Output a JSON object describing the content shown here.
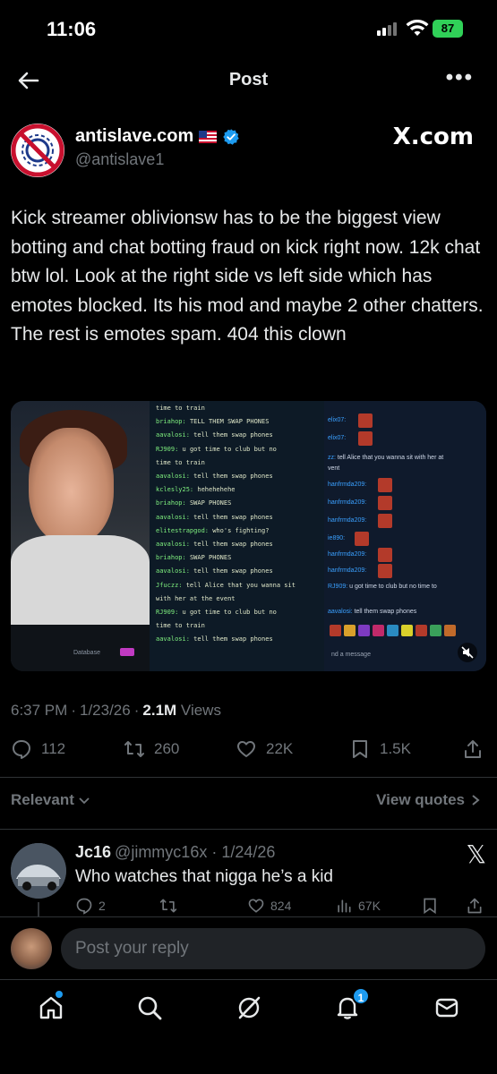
{
  "status_bar": {
    "time": "11:06",
    "battery": "87"
  },
  "header": {
    "title": "Post"
  },
  "post": {
    "author_name": "antislave.com",
    "author_handle": "@antislave1",
    "affiliate_label": "X.com",
    "text": "Kick streamer oblivionsw has to be the biggest view botting and chat botting fraud on kick right now. 12k chat btw lol. Look at the right side vs left side which has emotes blocked. Its his mod and maybe 2 other chatters. The rest is emotes spam. 404 this clown",
    "time": "6:37 PM",
    "date": "1/23/26",
    "views_count": "2.1M",
    "views_label": "Views",
    "replies": "112",
    "reposts": "260",
    "likes": "22K",
    "bookmarks": "1.5K"
  },
  "media": {
    "desk_label": "Database",
    "chat_left": [
      {
        "user": "",
        "msg": "time to train"
      },
      {
        "user": "briahop:",
        "msg": "TELL THEM SWAP PHONES"
      },
      {
        "user": "aavalosi:",
        "msg": "tell them swap phones"
      },
      {
        "user": "RJ909:",
        "msg": "u got time to club but no"
      },
      {
        "user": "",
        "msg": "time to train"
      },
      {
        "user": "aavalosi:",
        "msg": "tell them swap phones"
      },
      {
        "user": "kclesly25:",
        "msg": "hehehehehe"
      },
      {
        "user": "briahop:",
        "msg": "SWAP PHONES"
      },
      {
        "user": "aavalosi:",
        "msg": "tell them swap phones"
      },
      {
        "user": "elitestrapgod:",
        "msg": "who's fighting?"
      },
      {
        "user": "aavalosi:",
        "msg": "tell them swap phones"
      },
      {
        "user": "briahop:",
        "msg": "SWAP PHONES"
      },
      {
        "user": "aavalosi:",
        "msg": "tell them swap phones"
      },
      {
        "user": "Jfuczz:",
        "msg": "tell Alice that you wanna sit"
      },
      {
        "user": "",
        "msg": "with her at the event"
      },
      {
        "user": "RJ909:",
        "msg": "u got time to club but no"
      },
      {
        "user": "",
        "msg": "time to train"
      },
      {
        "user": "aavalosi:",
        "msg": "tell them swap phones"
      }
    ],
    "chat_right": [
      {
        "user": "elix07:",
        "msg": ""
      },
      {
        "user": "elix07:",
        "msg": ""
      },
      {
        "user": "zz:",
        "msg": "tell Alice that you wanna sit with her at"
      },
      {
        "user": "",
        "msg": "vent"
      },
      {
        "user": "hanfrmda209:",
        "msg": ""
      },
      {
        "user": "hanfrmda209:",
        "msg": ""
      },
      {
        "user": "hanfrmda209:",
        "msg": ""
      },
      {
        "user": "ie890:",
        "msg": ""
      },
      {
        "user": "hanfrmda209:",
        "msg": ""
      },
      {
        "user": "hanfrmda209:",
        "msg": ""
      },
      {
        "user": "RJ909:",
        "msg": "u got time to club but no time to"
      },
      {
        "user": "aavalosi:",
        "msg": "tell them swap phones"
      }
    ],
    "input_placeholder": "nd a message"
  },
  "sort": {
    "label": "Relevant",
    "view_quotes": "View quotes"
  },
  "reply": {
    "name": "Jc16",
    "handle": "@jimmyc16x",
    "date": "1/24/26",
    "text": "Who watches that nigga he’s a kid",
    "replies": "2",
    "likes": "824",
    "views": "67K"
  },
  "composer": {
    "placeholder": "Post your reply"
  },
  "tabbar": {
    "notifications_badge": "1"
  },
  "colors": {
    "accent": "#1d9bf0",
    "muted": "#71767b",
    "text": "#e7e9ea",
    "battery": "#30d158"
  }
}
